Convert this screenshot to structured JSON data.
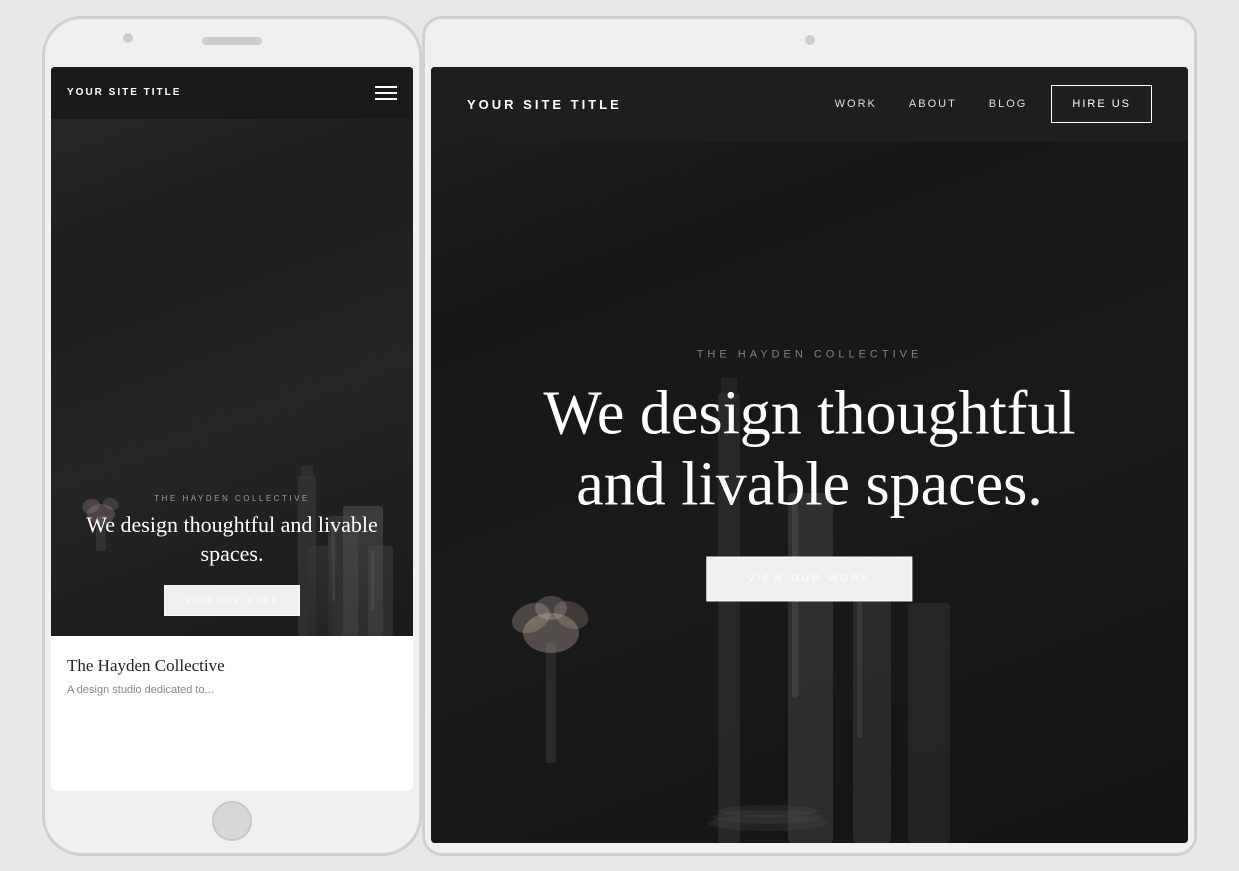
{
  "colors": {
    "bg": "#e8e8e8",
    "device_shell": "#f0f0f0",
    "screen_bg": "#1e1e1e",
    "text_white": "#ffffff",
    "text_muted": "rgba(255,255,255,0.5)"
  },
  "mobile": {
    "site_title": "YOUR SITE TITLE",
    "subtitle": "THE HAYDEN COLLECTIVE",
    "headline": "We design thoughtful and livable spaces.",
    "cta_label": "VIEW OUR WORK",
    "bottom_title": "The Hayden Collective",
    "bottom_text": "A design studio dedicated to..."
  },
  "desktop": {
    "site_title": "YOUR SITE TITLE",
    "nav": {
      "work": "WORK",
      "about": "ABOUT",
      "blog": "BLOG",
      "hire_us": "HIRE US"
    },
    "subtitle": "THE HAYDEN COLLECTIVE",
    "headline_line1": "We design thoughtful",
    "headline_line2": "and livable spaces.",
    "cta_label": "VIEW OUR WORK"
  }
}
